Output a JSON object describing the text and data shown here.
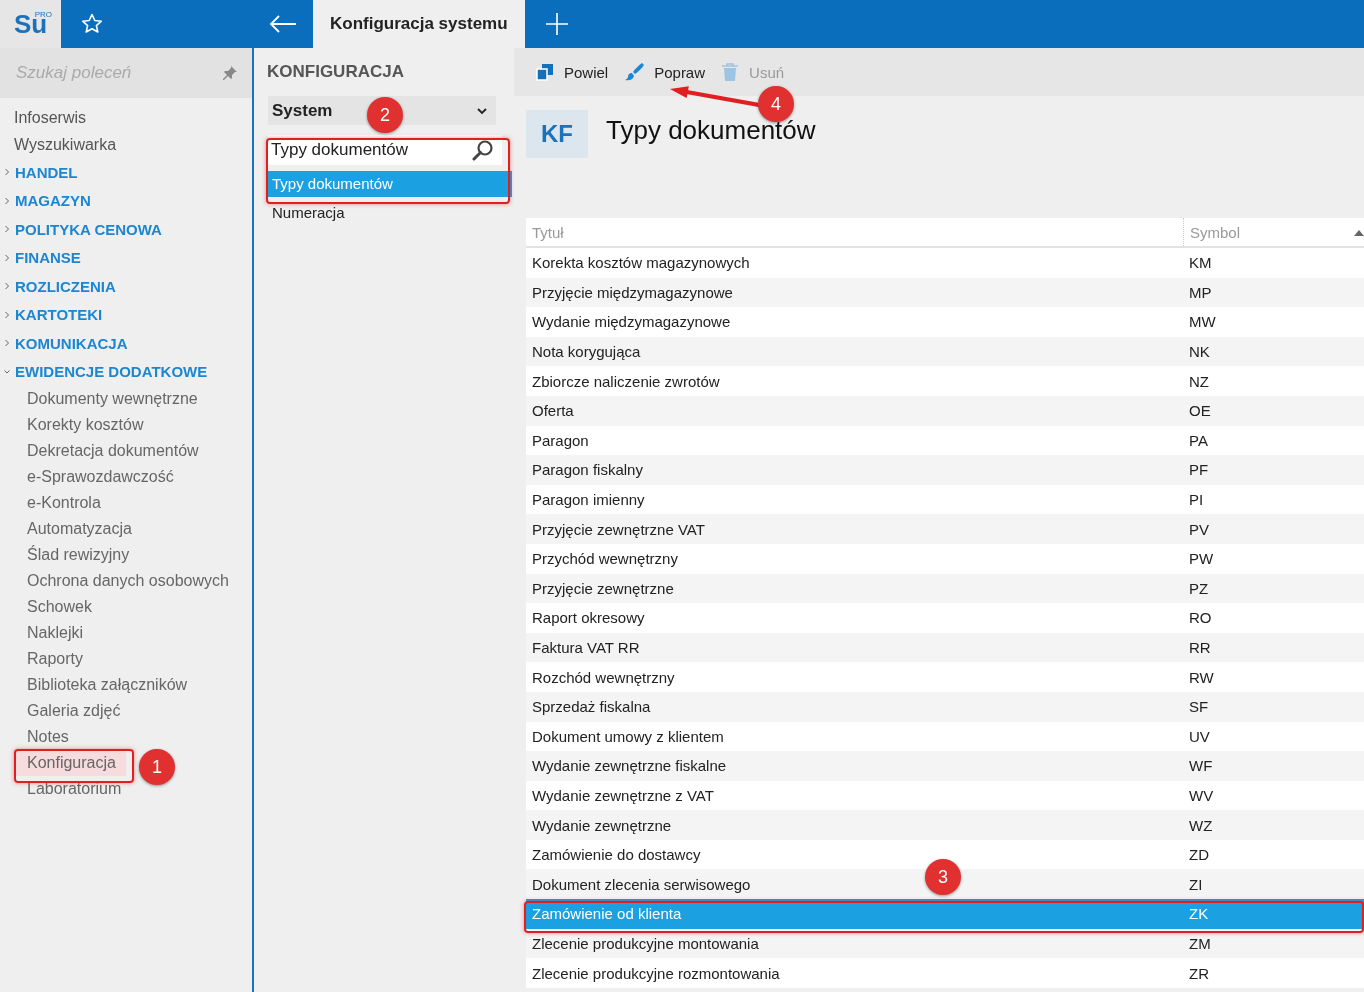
{
  "app": {
    "logo": "Su",
    "logo_badge": "PRO"
  },
  "tabs": [
    {
      "label": "Konfiguracja systemu",
      "selected": true
    }
  ],
  "sidebar": {
    "search": {
      "placeholder": "Szukaj poleceń"
    },
    "items": [
      {
        "kind": "item",
        "label": "Infoserwis"
      },
      {
        "kind": "item",
        "label": "Wyszukiwarka"
      },
      {
        "kind": "group",
        "label": "HANDEL",
        "expanded": false
      },
      {
        "kind": "group",
        "label": "MAGAZYN",
        "expanded": false
      },
      {
        "kind": "group",
        "label": "POLITYKA CENOWA",
        "expanded": false
      },
      {
        "kind": "group",
        "label": "FINANSE",
        "expanded": false
      },
      {
        "kind": "group",
        "label": "ROZLICZENIA",
        "expanded": false
      },
      {
        "kind": "group",
        "label": "KARTOTEKI",
        "expanded": false
      },
      {
        "kind": "group",
        "label": "KOMUNIKACJA",
        "expanded": false
      },
      {
        "kind": "group",
        "label": "EWIDENCJE DODATKOWE",
        "expanded": true,
        "children": [
          {
            "label": "Dokumenty wewnętrzne",
            "selected": false
          },
          {
            "label": "Korekty kosztów",
            "selected": false
          },
          {
            "label": "Dekretacja dokumentów",
            "selected": false
          },
          {
            "label": "e-Sprawozdawczość",
            "selected": false
          },
          {
            "label": "e-Kontrola",
            "selected": false
          },
          {
            "label": "Automatyzacja",
            "selected": false
          },
          {
            "label": "Ślad rewizyjny",
            "selected": false
          },
          {
            "label": "Ochrona danych osobowych",
            "selected": false
          },
          {
            "label": "Schowek",
            "selected": false
          },
          {
            "label": "Naklejki",
            "selected": false
          },
          {
            "label": "Raporty",
            "selected": false
          },
          {
            "label": "Biblioteka załączników",
            "selected": false
          },
          {
            "label": "Galeria zdjęć",
            "selected": false
          },
          {
            "label": "Notes",
            "selected": false
          },
          {
            "label": "Konfiguracja",
            "selected": true
          },
          {
            "label": "Laboratorium",
            "selected": false
          }
        ]
      }
    ]
  },
  "config": {
    "title": "KONFIGURACJA",
    "section": "System",
    "search": {
      "value": "Typy dokumentów"
    },
    "results": [
      {
        "label": "Typy dokumentów",
        "selected": true
      },
      {
        "label": "Numeracja",
        "selected": false
      }
    ]
  },
  "toolbar": [
    {
      "kind": "copy",
      "label": "Powiel",
      "disabled": false
    },
    {
      "kind": "edit",
      "label": "Popraw",
      "disabled": false
    },
    {
      "kind": "delete",
      "label": "Usuń",
      "disabled": true
    }
  ],
  "page": {
    "badge": "KF",
    "title": "Typy dokumentów"
  },
  "table": {
    "columns": [
      "Tytuł",
      "Symbol"
    ],
    "rows": [
      {
        "title": "Korekta kosztów magazynowych",
        "symbol": "KM",
        "selected": false
      },
      {
        "title": "Przyjęcie międzymagazynowe",
        "symbol": "MP",
        "selected": false
      },
      {
        "title": "Wydanie międzymagazynowe",
        "symbol": "MW",
        "selected": false
      },
      {
        "title": "Nota korygująca",
        "symbol": "NK",
        "selected": false
      },
      {
        "title": "Zbiorcze naliczenie zwrotów",
        "symbol": "NZ",
        "selected": false
      },
      {
        "title": "Oferta",
        "symbol": "OE",
        "selected": false
      },
      {
        "title": "Paragon",
        "symbol": "PA",
        "selected": false
      },
      {
        "title": "Paragon fiskalny",
        "symbol": "PF",
        "selected": false
      },
      {
        "title": "Paragon imienny",
        "symbol": "PI",
        "selected": false
      },
      {
        "title": "Przyjęcie zewnętrzne VAT",
        "symbol": "PV",
        "selected": false
      },
      {
        "title": "Przychód wewnętrzny",
        "symbol": "PW",
        "selected": false
      },
      {
        "title": "Przyjęcie zewnętrzne",
        "symbol": "PZ",
        "selected": false
      },
      {
        "title": "Raport okresowy",
        "symbol": "RO",
        "selected": false
      },
      {
        "title": "Faktura VAT RR",
        "symbol": "RR",
        "selected": false
      },
      {
        "title": "Rozchód wewnętrzny",
        "symbol": "RW",
        "selected": false
      },
      {
        "title": "Sprzedaż fiskalna",
        "symbol": "SF",
        "selected": false
      },
      {
        "title": "Dokument umowy z klientem",
        "symbol": "UV",
        "selected": false
      },
      {
        "title": "Wydanie zewnętrzne fiskalne",
        "symbol": "WF",
        "selected": false
      },
      {
        "title": "Wydanie zewnętrzne z VAT",
        "symbol": "WV",
        "selected": false
      },
      {
        "title": "Wydanie zewnętrzne",
        "symbol": "WZ",
        "selected": false
      },
      {
        "title": "Zamówienie do dostawcy",
        "symbol": "ZD",
        "selected": false
      },
      {
        "title": "Dokument zlecenia serwisowego",
        "symbol": "ZI",
        "selected": false
      },
      {
        "title": "Zamówienie od klienta",
        "symbol": "ZK",
        "selected": true
      },
      {
        "title": "Zlecenie produkcyjne montowania",
        "symbol": "ZM",
        "selected": false
      },
      {
        "title": "Zlecenie produkcyjne rozmontowania",
        "symbol": "ZR",
        "selected": false
      }
    ]
  },
  "annotations": [
    {
      "number": "1"
    },
    {
      "number": "2"
    },
    {
      "number": "3"
    },
    {
      "number": "4"
    }
  ]
}
